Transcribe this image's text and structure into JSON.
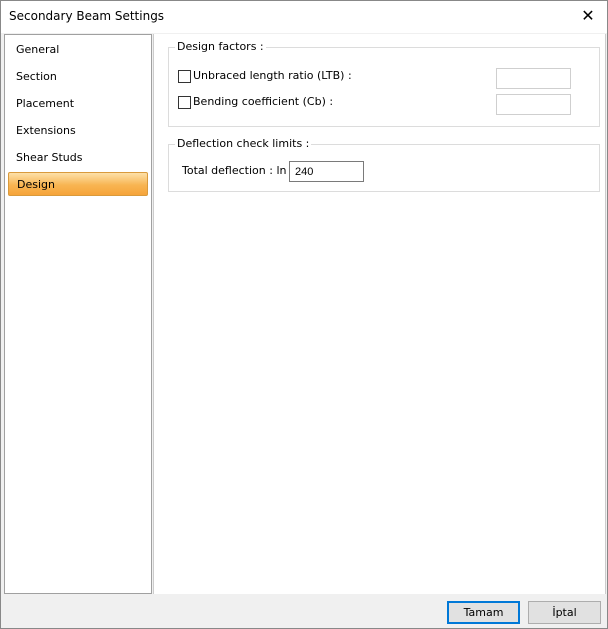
{
  "window": {
    "title": "Secondary Beam Settings",
    "close_icon": "close-icon"
  },
  "sidebar": {
    "items": [
      {
        "label": "General"
      },
      {
        "label": "Section"
      },
      {
        "label": "Placement"
      },
      {
        "label": "Extensions"
      },
      {
        "label": "Shear Studs"
      },
      {
        "label": "Design",
        "active": true
      }
    ]
  },
  "design_factors": {
    "legend": "Design factors :",
    "ltb": {
      "label": "Unbraced length ratio (LTB) :",
      "checked": false,
      "value": ""
    },
    "cb": {
      "label": "Bending coefficient (Cb) :",
      "checked": false,
      "value": ""
    }
  },
  "deflection": {
    "legend": "Deflection check limits :",
    "total_label": "Total deflection : ln /",
    "total_value": "240"
  },
  "buttons": {
    "ok": "Tamam",
    "cancel": "İptal"
  },
  "colors": {
    "accent": "#0078d7",
    "active_nav": "#f8b552"
  }
}
